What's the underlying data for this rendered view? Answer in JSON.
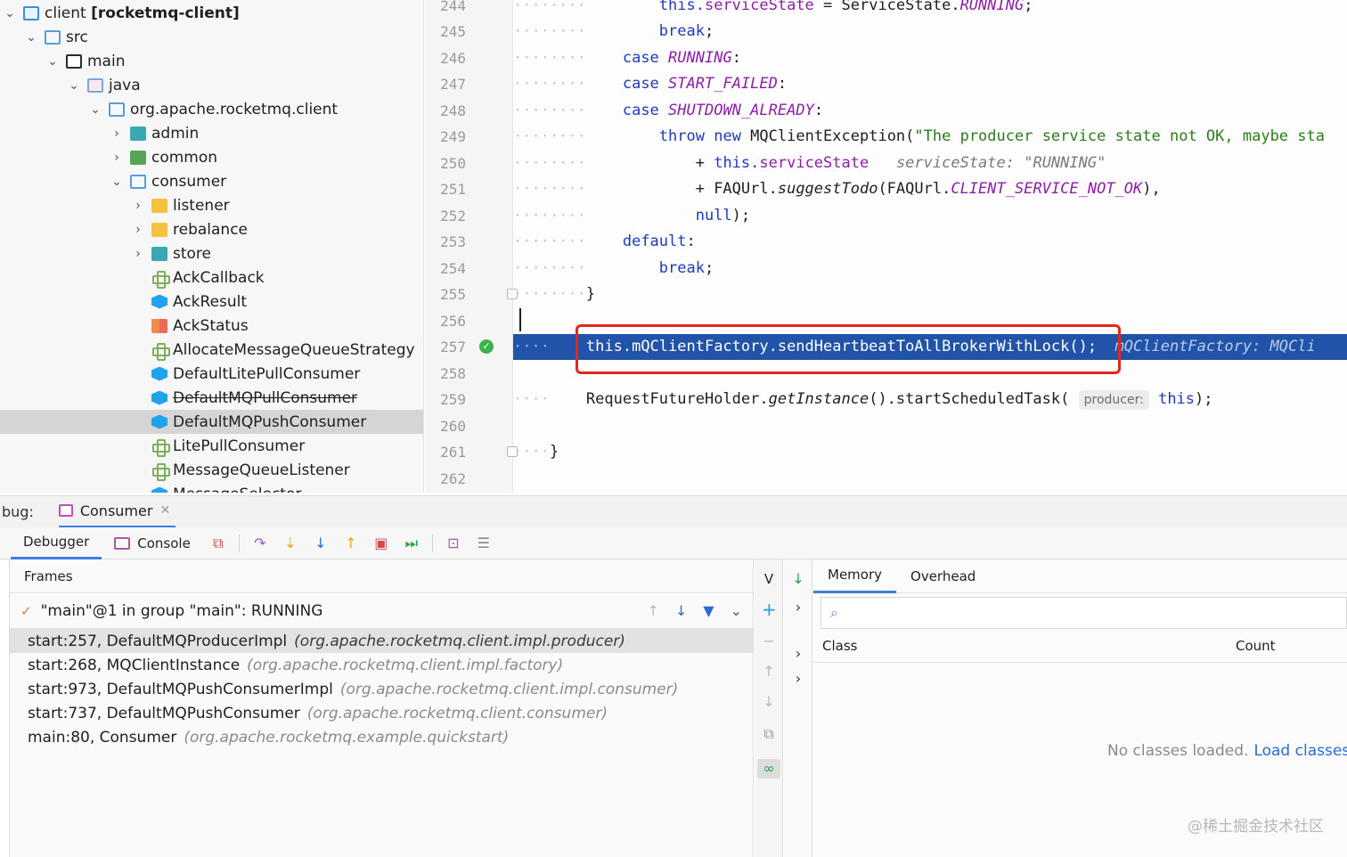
{
  "project_tree": {
    "rows": [
      {
        "label_main": "client",
        "label_bold": "[rocketmq-client]",
        "icon": "folder-module-icon"
      },
      {
        "label": "src",
        "icon": "folder-src-icon"
      },
      {
        "label": "main",
        "icon": "folder-icon"
      },
      {
        "label": "java",
        "icon": "source-root-icon"
      },
      {
        "label": "org.apache.rocketmq.client",
        "icon": "package-icon"
      },
      {
        "label": "admin",
        "icon": "package-icon"
      },
      {
        "label": "common",
        "icon": "package-icon"
      },
      {
        "label": "consumer",
        "icon": "package-icon"
      },
      {
        "label": "listener",
        "icon": "package-icon"
      },
      {
        "label": "rebalance",
        "icon": "package-icon"
      },
      {
        "label": "store",
        "icon": "package-icon"
      },
      {
        "label": "AckCallback",
        "icon": "interface-icon"
      },
      {
        "label": "AckResult",
        "icon": "class-icon"
      },
      {
        "label": "AckStatus",
        "icon": "enum-icon"
      },
      {
        "label": "AllocateMessageQueueStrategy",
        "icon": "interface-icon"
      },
      {
        "label": "DefaultLitePullConsumer",
        "icon": "class-icon"
      },
      {
        "label": "DefaultMQPullConsumer",
        "icon": "class-icon"
      },
      {
        "label": "DefaultMQPushConsumer",
        "icon": "class-icon"
      },
      {
        "label": "LitePullConsumer",
        "icon": "interface-icon"
      },
      {
        "label": "MessageQueueListener",
        "icon": "interface-icon"
      },
      {
        "label": "MessageSelector",
        "icon": "class-icon"
      }
    ]
  },
  "editor": {
    "line_numbers": [
      "244",
      "245",
      "246",
      "247",
      "248",
      "249",
      "250",
      "251",
      "252",
      "253",
      "254",
      "255",
      "256",
      "257",
      "258",
      "259",
      "260",
      "261",
      "262"
    ],
    "code": {
      "l244_a": "this.",
      "l244_b": "serviceState",
      "l244_c": " = ServiceState.",
      "l244_d": "RUNNING",
      "l244_e": ";",
      "l245": "break",
      "l245_e": ";",
      "l246_kw": "case",
      "l246_en": "RUNNING",
      "l246_e": ":",
      "l247_kw": "case",
      "l247_en": "START_FAILED",
      "l247_e": ":",
      "l248_kw": "case",
      "l248_en": "SHUTDOWN_ALREADY",
      "l248_e": ":",
      "l249_kw1": "throw",
      "l249_kw2": "new",
      "l249_a": " MQClientException(",
      "l249_str": "\"The producer service state not OK, maybe sta",
      "l250_a": "+ ",
      "l250_kw": "this.",
      "l250_fld": "serviceState",
      "l250_hint": "serviceState: \"RUNNING\"",
      "l251_a": "+ FAQUrl.",
      "l251_m": "suggestTodo",
      "l251_b": "(FAQUrl.",
      "l251_en": "CLIENT_SERVICE_NOT_OK",
      "l251_e": "),",
      "l252_kw": "null",
      "l252_e": ");",
      "l253_kw": "default",
      "l253_e": ":",
      "l254_kw": "break",
      "l254_e": ";",
      "l255": "}",
      "l257": "this.mQClientFactory.sendHeartbeatToAllBrokerWithLock();",
      "l257_hint": "mQClientFactory: MQCli",
      "l259_a": "RequestFutureHolder.",
      "l259_m": "getInstance",
      "l259_b": "().startScheduledTask(",
      "l259_hint": "producer:",
      "l259_kw": "this",
      "l259_e": ");",
      "l261": "}"
    }
  },
  "debug": {
    "title_prefix": "bug:",
    "session_tab": "Consumer",
    "tabs": {
      "debugger": "Debugger",
      "console": "Console"
    },
    "frames_header": "Frames",
    "thread": "\"main\"@1 in group \"main\": RUNNING",
    "frames": [
      {
        "method": "start:257, DefaultMQProducerImpl",
        "pkg": "(org.apache.rocketmq.client.impl.producer)"
      },
      {
        "method": "start:268, MQClientInstance",
        "pkg": "(org.apache.rocketmq.client.impl.factory)"
      },
      {
        "method": "start:973, DefaultMQPushConsumerImpl",
        "pkg": "(org.apache.rocketmq.client.impl.consumer)"
      },
      {
        "method": "start:737, DefaultMQPushConsumer",
        "pkg": "(org.apache.rocketmq.client.consumer)"
      },
      {
        "method": "main:80, Consumer",
        "pkg": "(org.apache.rocketmq.example.quickstart)"
      }
    ],
    "vars_label": "V",
    "memory": {
      "tabs": [
        "Memory",
        "Overhead"
      ],
      "col_class": "Class",
      "col_count": "Count",
      "empty_text": "No classes loaded.",
      "empty_link": "Load classes"
    }
  },
  "watermark": "@稀土掘金技术社区",
  "colors": {
    "accent": "#3d7ee3",
    "exec_line": "#2154a8",
    "highlight_box": "#e3271b"
  }
}
